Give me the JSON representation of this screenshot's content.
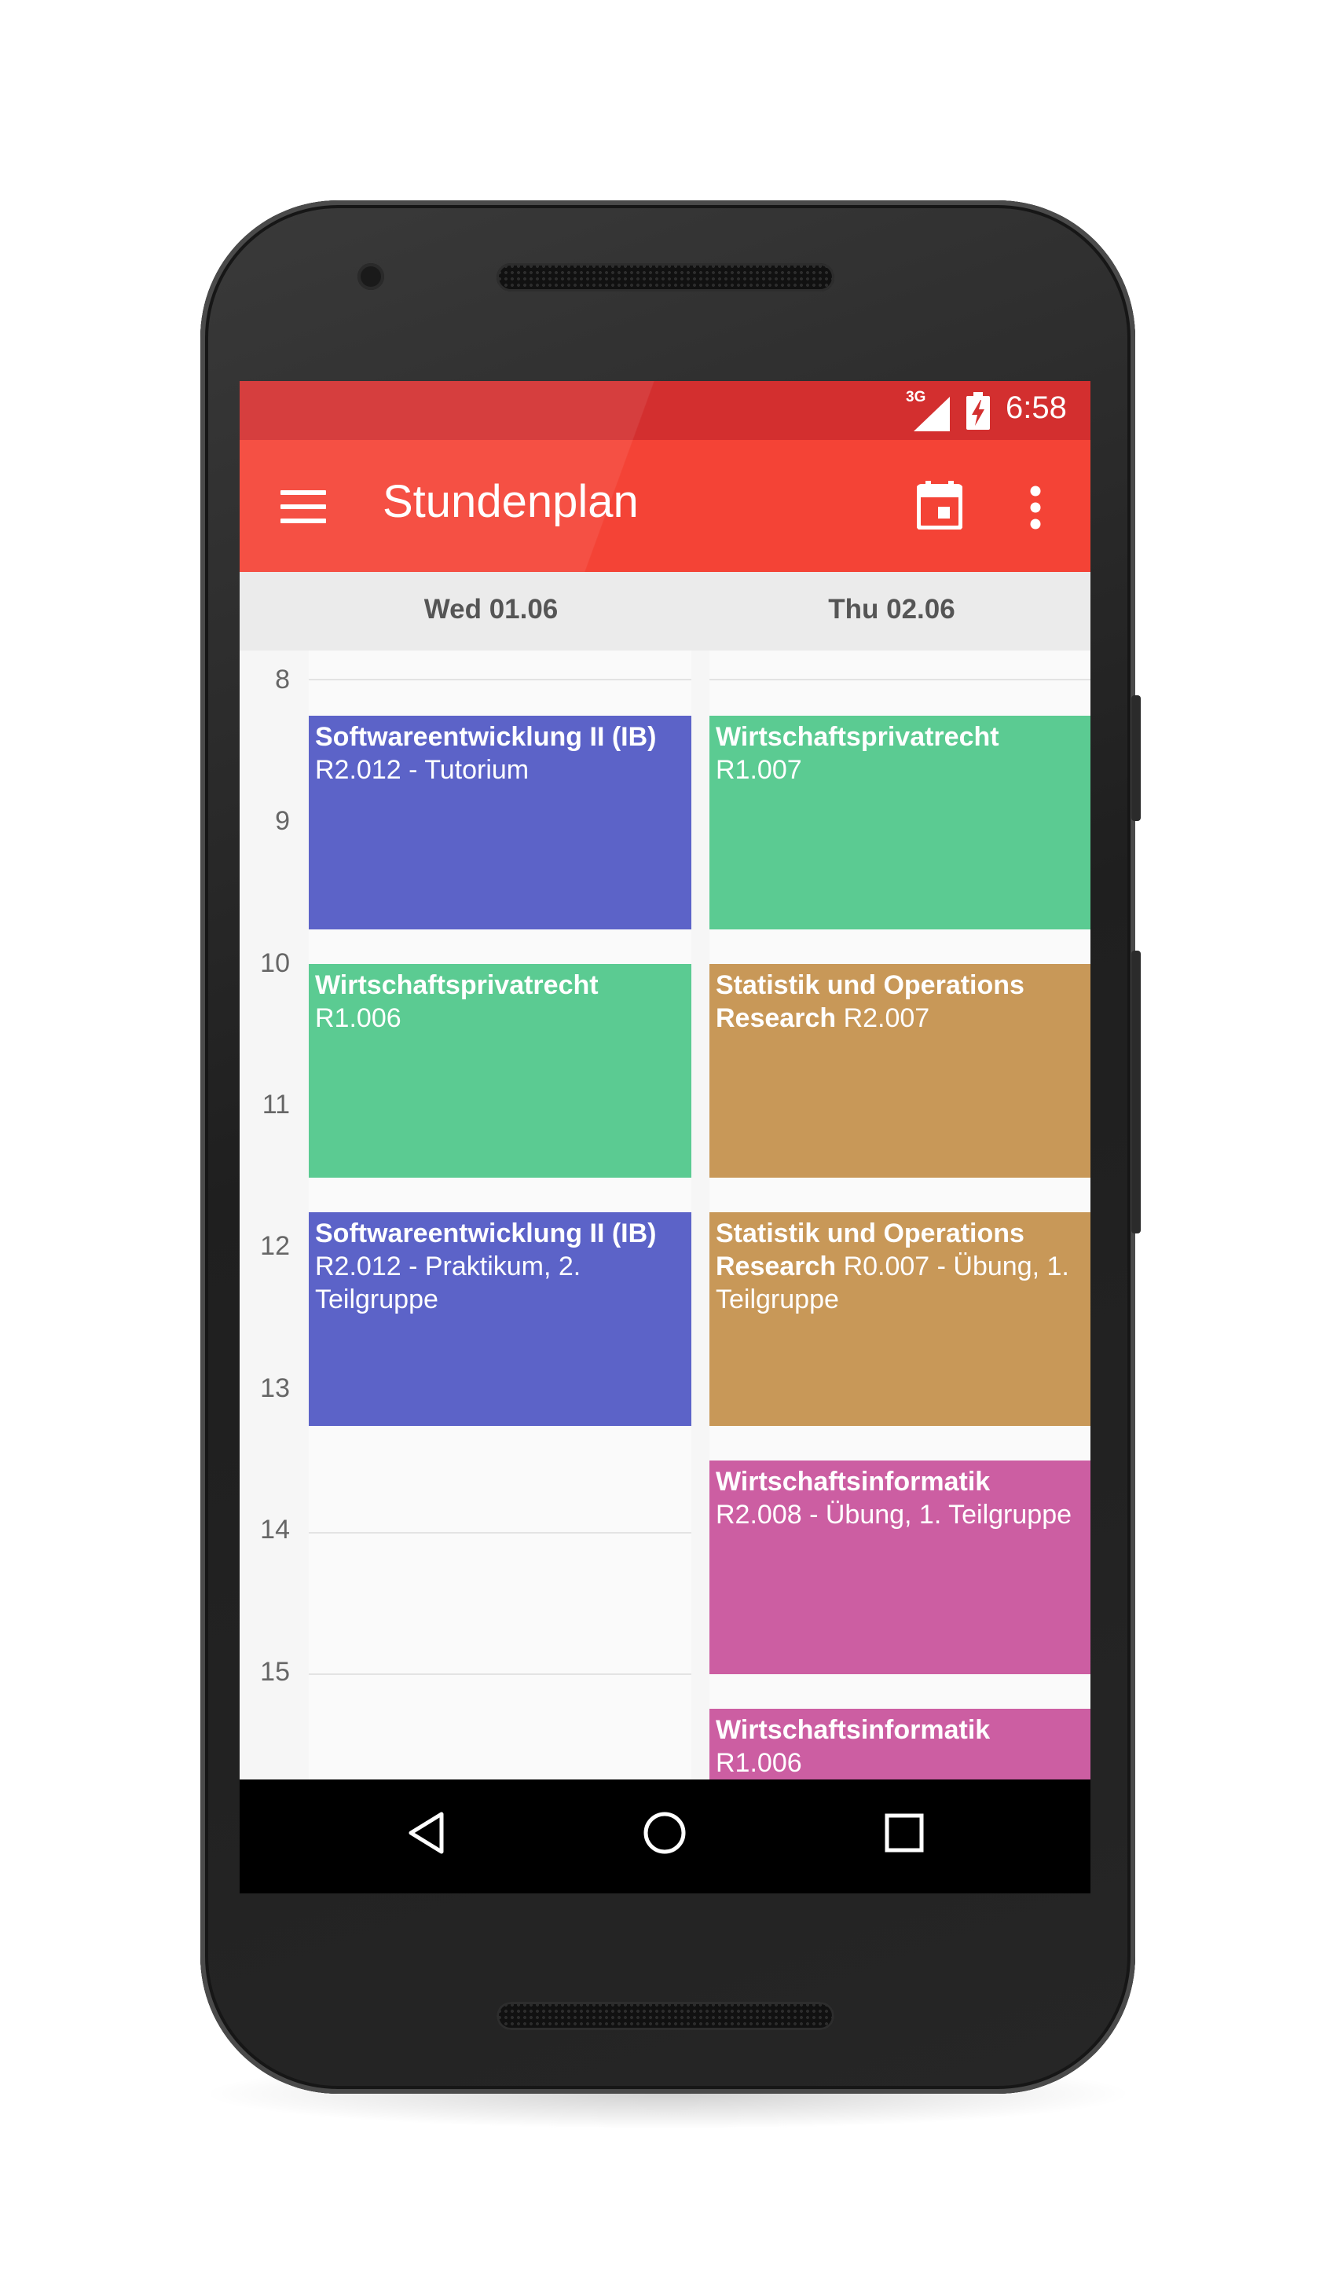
{
  "status_bar": {
    "network": "3G",
    "time": "6:58"
  },
  "toolbar": {
    "title": "Stundenplan",
    "icons": [
      "menu-icon",
      "calendar-icon",
      "more-vert-icon"
    ]
  },
  "days": [
    {
      "label": "Wed 01.06"
    },
    {
      "label": "Thu 02.06"
    }
  ],
  "hours": [
    "8",
    "9",
    "10",
    "11",
    "12",
    "13",
    "14",
    "15"
  ],
  "events": {
    "wed": [
      {
        "title": "Softwareentwicklung II (IB)",
        "detail": "R2.012 - Tutorium",
        "color": "#5c63c8"
      },
      {
        "title": "Wirtschaftsprivatrecht",
        "detail": "R1.006",
        "color": "#5bcb92"
      },
      {
        "title": "Softwareentwicklung II (IB)",
        "detail": "R2.012 - Praktikum, 2. Teilgruppe",
        "color": "#5c63c8"
      }
    ],
    "thu": [
      {
        "title": "Wirtschaftsprivatrecht",
        "detail": "R1.007",
        "color": "#5bcb92"
      },
      {
        "title": "Statistik und Operations Research",
        "detail": "R2.007",
        "color": "#c89858"
      },
      {
        "title": "Statistik und Operations Research",
        "detail": "R0.007 - Übung, 1. Teilgruppe",
        "color": "#c89858"
      },
      {
        "title": "Wirtschaftsinformatik",
        "detail": "R2.008 - Übung, 1. Teilgruppe",
        "color": "#cc5ea2"
      },
      {
        "title": "Wirtschaftsinformatik",
        "detail": "R1.006",
        "color": "#cc5ea2"
      }
    ]
  },
  "colors": {
    "status_bar": "#d32f2f",
    "toolbar": "#f44336",
    "blue_event": "#5c63c8",
    "green_event": "#5bcb92",
    "orange_event": "#c89858",
    "pink_event": "#cc5ea2"
  },
  "navigation": {
    "icons": [
      "back-icon",
      "home-icon",
      "recents-icon"
    ]
  }
}
